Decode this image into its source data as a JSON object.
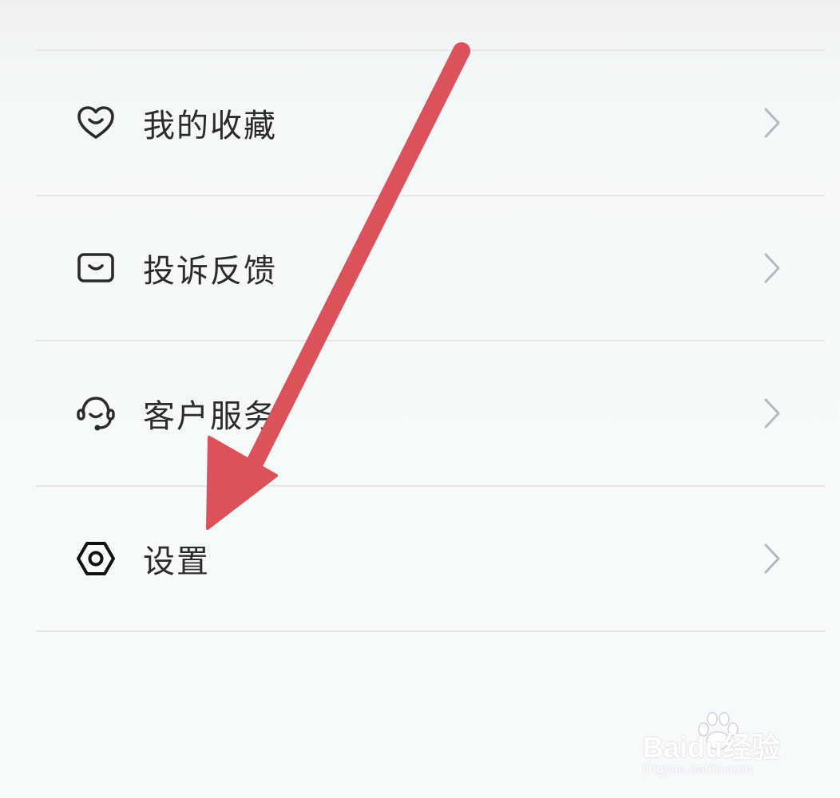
{
  "menu": {
    "items": [
      {
        "label": "我的收藏",
        "icon": "heart-icon"
      },
      {
        "label": "投诉反馈",
        "icon": "feedback-icon"
      },
      {
        "label": "客户服务",
        "icon": "headset-icon"
      },
      {
        "label": "设置",
        "icon": "settings-icon"
      }
    ]
  },
  "colors": {
    "background": "#f6f9fa",
    "divider": "#e4e6e8",
    "text": "#2b2b2b",
    "icon": "#2b2b2b",
    "chevron": "#b5b8bb",
    "annotation_arrow": "#db525a"
  },
  "watermark": {
    "brand": "Baidu经验",
    "url": "jingyan.baidu.com"
  }
}
